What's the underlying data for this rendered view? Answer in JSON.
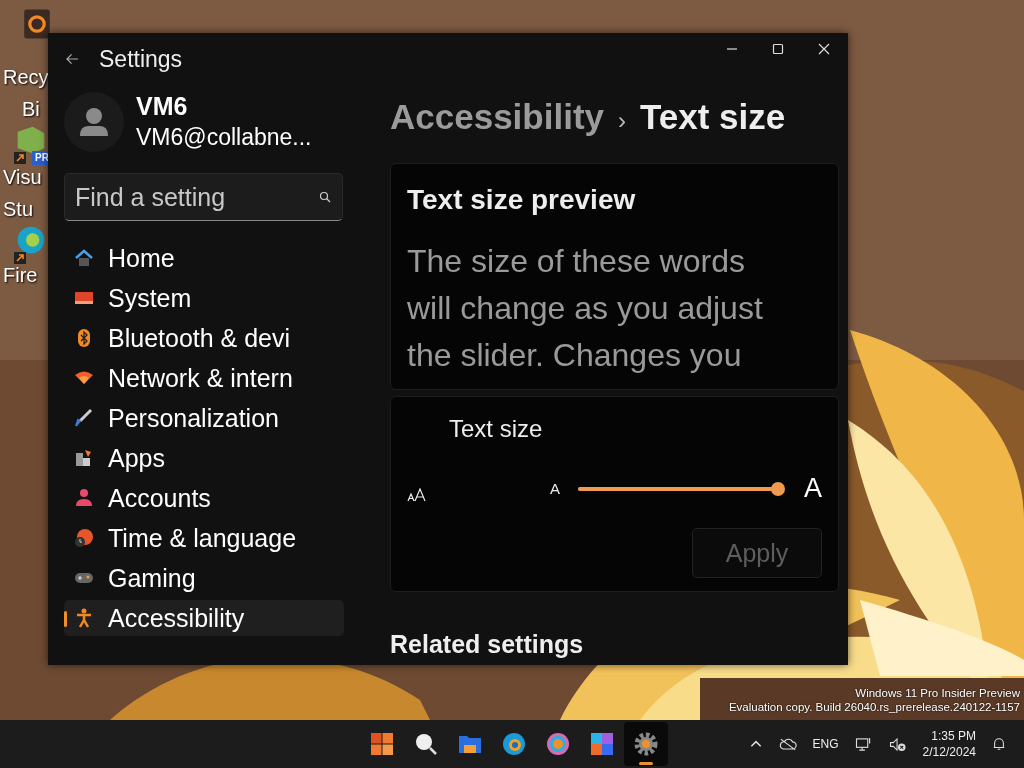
{
  "desktop": {
    "icons": [
      {
        "lines": [
          "Recy",
          "Bi"
        ],
        "shortcut": false
      },
      {
        "lines": [
          "Visu",
          "Stu"
        ],
        "shortcut": true,
        "badge": "PR"
      },
      {
        "lines": [
          "Fire"
        ],
        "shortcut": true
      }
    ],
    "watermark": [
      "Windows 11 Pro Insider Preview",
      "Evaluation copy. Build 26040.rs_prerelease.240122-1157"
    ]
  },
  "window": {
    "title": "Settings"
  },
  "account": {
    "name": "VM6",
    "email": "VM6@collabne..."
  },
  "search": {
    "placeholder": "Find a setting"
  },
  "nav": [
    {
      "label": "Home",
      "selected": false
    },
    {
      "label": "System",
      "selected": false
    },
    {
      "label": "Bluetooth & devi",
      "selected": false
    },
    {
      "label": "Network & intern",
      "selected": false
    },
    {
      "label": "Personalization",
      "selected": false
    },
    {
      "label": "Apps",
      "selected": false
    },
    {
      "label": "Accounts",
      "selected": false
    },
    {
      "label": "Time & language",
      "selected": false
    },
    {
      "label": "Gaming",
      "selected": false
    },
    {
      "label": "Accessibility",
      "selected": true
    }
  ],
  "breadcrumb": {
    "parent": "Accessibility",
    "separator": "›",
    "current": "Text size"
  },
  "preview": {
    "title": "Text size preview",
    "text": "The size of these words will change as you adjust the slider. Changes you"
  },
  "text_size": {
    "label": "Text size",
    "small_mark": "A",
    "large_mark": "A",
    "level": 1.0,
    "apply": {
      "label": "Apply",
      "disabled": true
    }
  },
  "related": {
    "title": "Related settings"
  },
  "taskbar": {
    "apps": [
      {
        "selected": false
      },
      {
        "selected": false
      },
      {
        "selected": false
      },
      {
        "selected": false
      },
      {
        "selected": false
      },
      {
        "selected": false
      },
      {
        "selected": true
      }
    ],
    "tray": {
      "language": "ENG",
      "time": "1:35 PM",
      "date": "2/12/2024"
    }
  }
}
